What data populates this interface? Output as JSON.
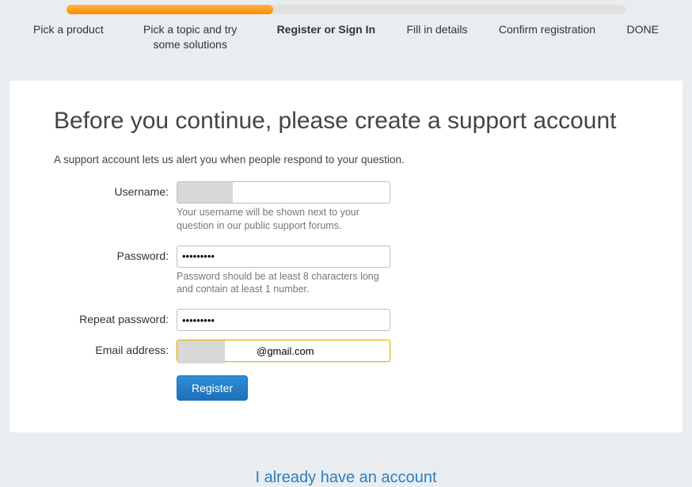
{
  "progress": {
    "steps": [
      {
        "label": "Pick a product",
        "active": false
      },
      {
        "label": "Pick a topic and try some solutions",
        "active": false
      },
      {
        "label": "Register or Sign In",
        "active": true
      },
      {
        "label": "Fill in details",
        "active": false
      },
      {
        "label": "Confirm registration",
        "active": false
      },
      {
        "label": "DONE",
        "active": false
      }
    ]
  },
  "card": {
    "heading": "Before you continue, please create a support account",
    "subtext": "A support account lets us alert you when people respond to your question."
  },
  "form": {
    "username": {
      "label": "Username:",
      "value": "",
      "hint": "Your username will be shown next to your question in our public support forums."
    },
    "password": {
      "label": "Password:",
      "value": "•••••••••",
      "hint": "Password should be at least 8 characters long and contain at least 1 number."
    },
    "repeat_password": {
      "label": "Repeat password:",
      "value": "•••••••••"
    },
    "email": {
      "label": "Email address:",
      "value": "          @gmail.com"
    },
    "register_label": "Register"
  },
  "already_link": "I already have an account"
}
